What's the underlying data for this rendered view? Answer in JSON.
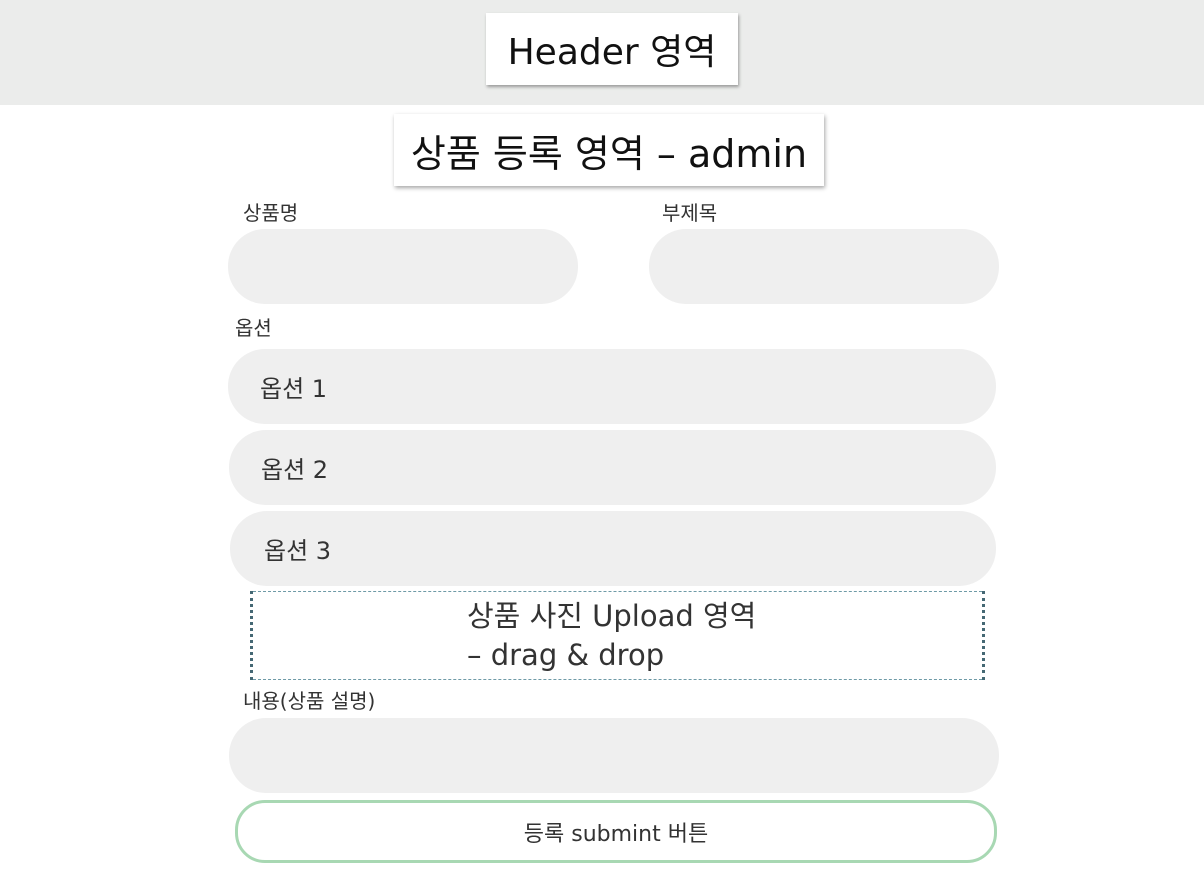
{
  "header": {
    "title": "Header 영역"
  },
  "section": {
    "title": "상품 등록 영역 – admin"
  },
  "form": {
    "product_name_label": "상품명",
    "subtitle_label": "부제목",
    "options_label": "옵션",
    "options": [
      "옵션 1",
      "옵션 2",
      "옵션 3"
    ],
    "upload": {
      "line1": "상품 사진 Upload 영역",
      "line2": "– drag & drop"
    },
    "content_label": "내용(상품 설명)",
    "submit_label": "등록 submint 버튼"
  },
  "colors": {
    "header_bg": "#ebeceb",
    "field_bg": "#efefef",
    "submit_border": "#a8d8b3",
    "upload_border": "#456874"
  }
}
